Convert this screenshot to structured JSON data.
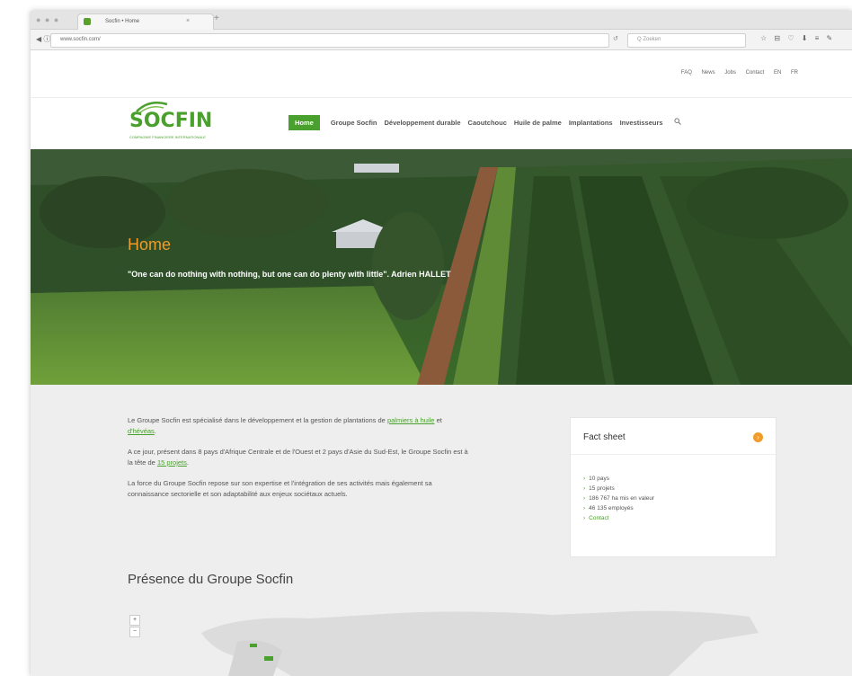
{
  "browser": {
    "tab_title": "Socfin • Home",
    "tab_close": "×",
    "new_tab": "+",
    "window_controls": "● ● ●",
    "nav_buttons": "◀ ⓘ ↻",
    "url": "www.socfin.com/",
    "reload": "↺",
    "search_placeholder": "Q Zoeken",
    "tool_icons": "☆ ⊟ ♡ ⬇ ≡ ✎"
  },
  "topnav": [
    "FAQ",
    "News",
    "Jobs",
    "Contact",
    "EN",
    "FR"
  ],
  "logo": {
    "text": "SOCFIN",
    "tagline": "COMPAGNIE FINANCIERE INTERNATIONALE"
  },
  "mainnav": [
    "Home",
    "Groupe Socfin",
    "Développement durable",
    "Caoutchouc",
    "Huile de palme",
    "Implantations",
    "Investisseurs"
  ],
  "hero": {
    "title": "Home",
    "quote": "\"One can do nothing with nothing, but one can do plenty with little\". Adrien HALLET"
  },
  "intro": {
    "p1_before": "Le Groupe Socfin est spécialisé dans le développement et la gestion de plantations de ",
    "p1_link1": "palmiers à huile",
    "p1_mid": " et ",
    "p1_link2": "d'hévéas",
    "p1_after": ".",
    "p2_before": "A ce jour, présent dans 8 pays d'Afrique Centrale et de l'Ouest et 2 pays d'Asie du Sud-Est, le Groupe Socfin est à la tête de ",
    "p2_link": "15 projets",
    "p2_after": ".",
    "p3": "La force du Groupe Socfin repose sur son expertise et l'intégration de ses activités mais également sa connaissance sectorielle et son adaptabilité aux enjeux sociétaux actuels."
  },
  "factsheet": {
    "title": "Fact sheet",
    "badge": "›",
    "items": [
      "10 pays",
      "15 projets",
      "186 767 ha mis en valeur",
      "46 135 employés"
    ],
    "contact": "Contact"
  },
  "presence": {
    "title": "Présence du Groupe Socfin"
  },
  "map": {
    "zoom_in": "+",
    "zoom_out": "−"
  },
  "colors": {
    "brand_green": "#4aa02c",
    "accent_orange": "#f09b2a"
  }
}
